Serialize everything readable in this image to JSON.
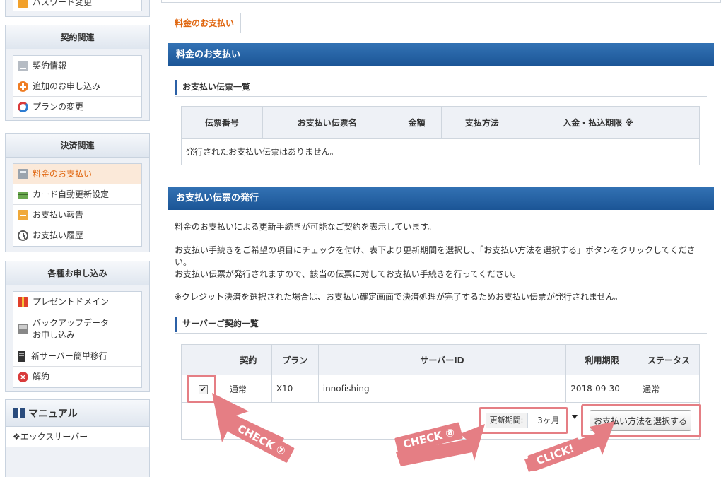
{
  "sidebar": {
    "top_item": "パスワード変更",
    "contract": {
      "title": "契約関連",
      "items": [
        {
          "label": "契約情報",
          "icon": "note-icon"
        },
        {
          "label": "追加のお申し込み",
          "icon": "plus-circle-icon"
        },
        {
          "label": "プランの変更",
          "icon": "cycle-icon"
        }
      ]
    },
    "payment": {
      "title": "決済関連",
      "items": [
        {
          "label": "料金のお支払い",
          "icon": "calculator-icon",
          "active": true
        },
        {
          "label": "カード自動更新設定",
          "icon": "card-icon"
        },
        {
          "label": "お支払い報告",
          "icon": "report-icon"
        },
        {
          "label": "お支払い履歴",
          "icon": "clock-icon"
        }
      ]
    },
    "apply": {
      "title": "各種お申し込み",
      "items": [
        {
          "label": "プレゼントドメイン",
          "icon": "gift-icon"
        },
        {
          "label": "バックアップデータ",
          "label2": "お申し込み",
          "icon": "backup-icon"
        },
        {
          "label": "新サーバー簡単移行",
          "icon": "server-icon"
        },
        {
          "label": "解約",
          "icon": "cancel-icon"
        }
      ]
    },
    "manual": {
      "title": "マニュアル",
      "item": "❖エックスサーバー"
    }
  },
  "main": {
    "tab": "料金のお支払い",
    "section1_title": "料金のお支払い",
    "list_title": "お支払い伝票一覧",
    "invoice_table": {
      "headers": [
        "伝票番号",
        "お支払い伝票名",
        "金額",
        "支払方法",
        "入金・払込期限 ※",
        ""
      ],
      "empty_message": "発行されたお支払い伝票はありません。"
    },
    "section2_title": "お支払い伝票の発行",
    "para1": "料金のお支払いによる更新手続きが可能なご契約を表示しています。",
    "para2": "お支払い手続きをご希望の項目にチェックを付け、表下より更新期間を選択し、「お支払い方法を選択する」ボタンをクリックしてくださ",
    "para2b": "い。",
    "para3": "お支払い伝票が発行されますので、該当の伝票に対してお支払い手続きを行ってください。",
    "para4": "※クレジット決済を選択された場合は、お支払い確定画面で決済処理が完了するためお支払い伝票が発行されません。",
    "server_title": "サーバーご契約一覧",
    "server_table": {
      "headers": [
        "",
        "契約",
        "プラン",
        "サーバーID",
        "利用期限",
        "ステータス"
      ],
      "row": {
        "checked": true,
        "contract": "通常",
        "plan": "X10",
        "server_id": "innofishing",
        "expiry": "2018-09-30",
        "status": "通常"
      }
    },
    "period_label": "更新期間:",
    "period_value": "3ヶ月",
    "pay_button": "お支払い方法を選択する"
  },
  "annotations": {
    "check7": "CHECK ⑦",
    "check8": "CHECK ⑧",
    "click": "CLICK!",
    "color": "#e57e84"
  }
}
